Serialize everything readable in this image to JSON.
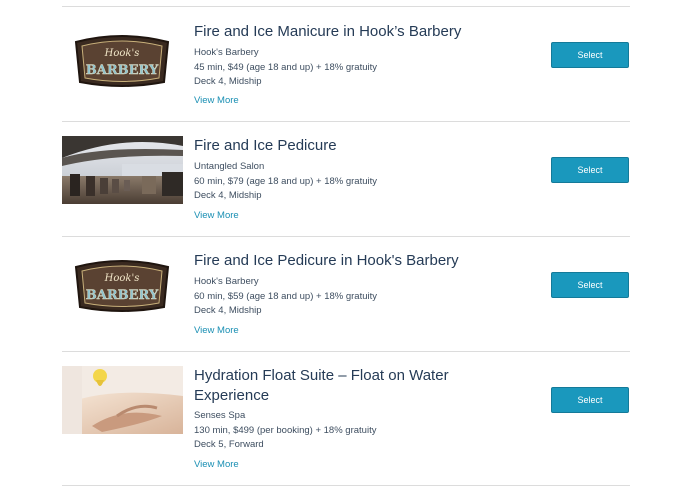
{
  "items": [
    {
      "title": "Fire and Ice Manicure in Hook’s Barbery",
      "location": "Hook's Barbery",
      "details": "45 min, $49 (age 18 and up) + 18% gratuity",
      "deck": "Deck 4, Midship",
      "more": "View More",
      "select": "Select",
      "image": "barbery-logo"
    },
    {
      "title": "Fire and Ice Pedicure",
      "location": "Untangled Salon",
      "details": "60 min, $79 (age 18 and up) + 18% gratuity",
      "deck": "Deck 4, Midship",
      "more": "View More",
      "select": "Select",
      "image": "salon-photo"
    },
    {
      "title": "Fire and Ice Pedicure in Hook's Barbery",
      "location": "Hook's Barbery",
      "details": "60 min, $59 (age 18 and up) + 18% gratuity",
      "deck": "Deck 4, Midship",
      "more": "View More",
      "select": "Select",
      "image": "barbery-logo"
    },
    {
      "title": "Hydration Float Suite – Float on Water Experience",
      "location": "Senses Spa",
      "details": "130 min, $499 (per booking) + 18% gratuity",
      "deck": "Deck 5, Forward",
      "more": "View More",
      "select": "Select",
      "image": "float-photo"
    }
  ],
  "logo_text": {
    "top": "Hook's",
    "bottom": "BARBERY"
  },
  "colors": {
    "accent": "#1a98bd",
    "link": "#1a8fb3",
    "title": "#253b56",
    "rule": "#dcdcdc"
  }
}
